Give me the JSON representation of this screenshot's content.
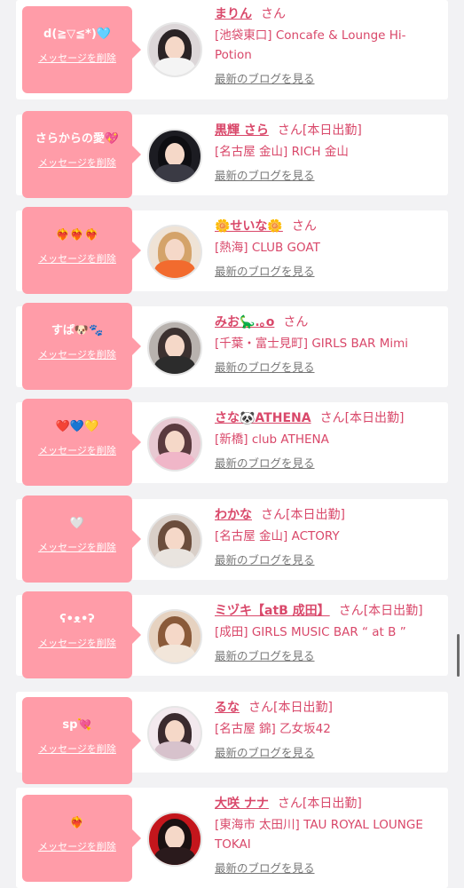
{
  "delete_label": "メッセージを削除",
  "san_label": "さん",
  "blog_label": "最新のブログを見る",
  "colors": {
    "bubble": "#ff9ca8",
    "name": "#d9486a",
    "card": "#ffffff",
    "background": "#f2f2f4"
  },
  "entries": [
    {
      "message": "d(≧▽≦*)🩵",
      "name": "まりん",
      "status": "",
      "shop": "[池袋東口] Concafe & Lounge Hi-Potion"
    },
    {
      "message": "さらからの愛💖",
      "name": "黒輝 さら",
      "status": "[本日出勤]",
      "shop": "[名古屋 金山] RICH 金山"
    },
    {
      "message": "❤️‍🔥❤️‍🔥❤️‍🔥",
      "name": "🌼せいな🌼",
      "status": "",
      "shop": "[熱海] CLUB GOAT"
    },
    {
      "message": "すぱ🐶🐾",
      "name": "みお🦕.｡o",
      "status": "",
      "shop": "[千葉・富士見町] GIRLS BAR Mimi"
    },
    {
      "message": "❤️💙💛",
      "name": "さな🐼ATHENA",
      "status": "[本日出勤]",
      "shop": "[新橋] club ATHENA"
    },
    {
      "message": "🤍",
      "name": "わかな",
      "status": "[本日出勤]",
      "shop": "[名古屋 金山] ACTORY"
    },
    {
      "message": "ʕ•ᴥ•ʔ",
      "name": "ミヅキ【atB 成田】",
      "status": "[本日出勤]",
      "shop": "[成田] GIRLS MUSIC BAR “ at B ”"
    },
    {
      "message": "sp💘",
      "name": "るな",
      "status": "[本日出勤]",
      "shop": "[名古屋 錦] 乙女坂42"
    },
    {
      "message": "❤️‍🔥",
      "name": "大咲 ナナ",
      "status": "[本日出勤]",
      "shop": "[東海市 太田川] TAU ROYAL LOUNGE TOKAI"
    }
  ]
}
